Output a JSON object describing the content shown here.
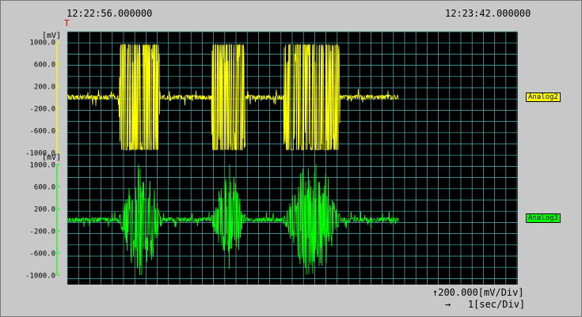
{
  "timestamps": {
    "start": "12:22:56.000000",
    "end": "12:23:42.000000"
  },
  "trigger_marker": "T",
  "scale": {
    "vertical": "↑200.000[mV/Div]",
    "horizontal": "→   1[sec/Div]"
  },
  "colors": {
    "plot_bg": "#000000",
    "grid": "#4fb8b8",
    "analog2": "#ffff00",
    "analog3": "#00ff00"
  },
  "chart_data": [
    {
      "type": "line",
      "name": "Analog2",
      "y_unit": "[mV]",
      "ylim": [
        -1000,
        1000
      ],
      "y_ticks": [
        "1000.0",
        "600.0",
        "200.0",
        "-200.0",
        "-600.0",
        "-1000.0"
      ],
      "x_unit": "sec",
      "xlim": [
        0,
        20
      ],
      "grid": true,
      "color": "#ffff00",
      "bursts": [
        {
          "x_start": 2.3,
          "x_end": 4.1,
          "amplitude": 950,
          "clipped": true
        },
        {
          "x_start": 6.4,
          "x_end": 7.9,
          "amplitude": 950,
          "clipped": true
        },
        {
          "x_start": 9.6,
          "x_end": 12.1,
          "amplitude": 950,
          "clipped": true
        }
      ],
      "baseline_noise": 25,
      "signal_end": 14.7
    },
    {
      "type": "line",
      "name": "Analog3",
      "y_unit": "[mV]",
      "ylim": [
        -1000,
        1000
      ],
      "y_ticks": [
        "1000.0",
        "600.0",
        "200.0",
        "-200.0",
        "-600.0",
        "-1000.0"
      ],
      "x_unit": "sec",
      "xlim": [
        0,
        20
      ],
      "grid": true,
      "color": "#00ff00",
      "bursts": [
        {
          "x_start": 2.3,
          "x_end": 4.2,
          "amplitude": 700,
          "clipped": false
        },
        {
          "x_start": 6.4,
          "x_end": 7.9,
          "amplitude": 650,
          "clipped": false
        },
        {
          "x_start": 9.6,
          "x_end": 12.1,
          "amplitude": 750,
          "clipped": false
        }
      ],
      "baseline_noise": 25,
      "signal_end": 14.7
    }
  ]
}
